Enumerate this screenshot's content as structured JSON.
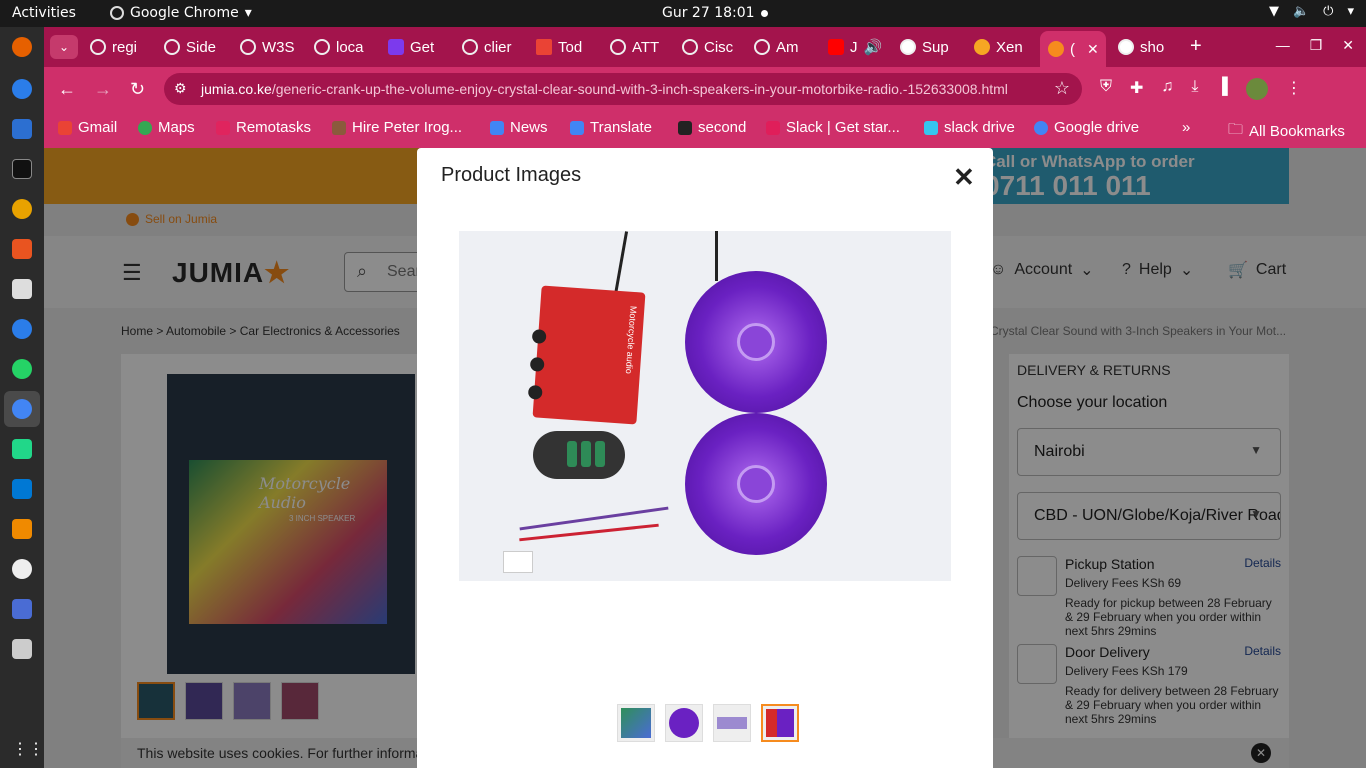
{
  "os": {
    "activities": "Activities",
    "app_name": "Google Chrome",
    "clock": "Gur 27  18:01"
  },
  "browser": {
    "tabs": [
      {
        "label": "regi"
      },
      {
        "label": "Side"
      },
      {
        "label": "W3S"
      },
      {
        "label": "loca"
      },
      {
        "label": "Get"
      },
      {
        "label": "clier"
      },
      {
        "label": "Tod"
      },
      {
        "label": "ATT"
      },
      {
        "label": "Cisc"
      },
      {
        "label": "Am"
      },
      {
        "label": "J"
      },
      {
        "label": "Sup"
      },
      {
        "label": "Xen"
      },
      {
        "label": "("
      },
      {
        "label": "sho"
      }
    ],
    "url_host": "jumia.co.ke",
    "url_path": "/generic-crank-up-the-volume-enjoy-crystal-clear-sound-with-3-inch-speakers-in-your-motorbike-radio.-152633008.html",
    "bookmarks": [
      {
        "label": "Gmail",
        "color": "#ea4335"
      },
      {
        "label": "Maps",
        "color": "#34a853"
      },
      {
        "label": "Remotasks",
        "color": "#e0245e"
      },
      {
        "label": "Hire Peter Irog...",
        "color": "#8b5a3c"
      },
      {
        "label": "News",
        "color": "#4285f4"
      },
      {
        "label": "Translate",
        "color": "#4285f4"
      },
      {
        "label": "second",
        "color": "#222222"
      },
      {
        "label": "Slack | Get star...",
        "color": "#e01e5a"
      },
      {
        "label": "slack drive",
        "color": "#36c5f0"
      },
      {
        "label": "Google drive",
        "color": "#4285f4"
      }
    ],
    "all_bookmarks": "All Bookmarks"
  },
  "page": {
    "promo_line1": "Call or WhatsApp to order",
    "promo_line2": "0711 011 011",
    "sell": "Sell on Jumia",
    "logo": "JUMIA",
    "search_placeholder": "Sear",
    "account": "Account",
    "help": "Help",
    "cart": "Cart",
    "breadcrumbs": "Home  >  Automobile  >  Car Electronics & Accessories",
    "breadcrumb_tail": "Crystal Clear Sound with 3-Inch Speakers in Your Mot...",
    "box_title": "Motorcycle Audio",
    "box_sub": "3 INCH SPEAKER",
    "delivery": {
      "heading": "DELIVERY & RETURNS",
      "choose": "Choose your location",
      "region": "Nairobi",
      "area": "CBD - UON/Globe/Koja/River Road",
      "options": [
        {
          "title": "Pickup Station",
          "details": "Details",
          "fee": "Delivery Fees KSh 69",
          "ready": "Ready for pickup between 28 February & 29 February when you order within next 5hrs 29mins"
        },
        {
          "title": "Door Delivery",
          "details": "Details",
          "fee": "Delivery Fees KSh 179",
          "ready": "Ready for delivery between 28 February & 29 February when you order within next 5hrs 29mins"
        }
      ]
    },
    "cookie_text": "This website uses cookies. For further informa"
  },
  "modal": {
    "title": "Product Images",
    "amp_label": "Motorcycle audio",
    "selected_thumb": 4,
    "thumb_count": 4
  },
  "colors": {
    "chrome_frame": "#a3144c",
    "chrome_toolbar": "#cf2f6a",
    "jumia_orange": "#f68b1e",
    "speaker_purple": "#6a21c2",
    "amp_red": "#d42a2a"
  }
}
